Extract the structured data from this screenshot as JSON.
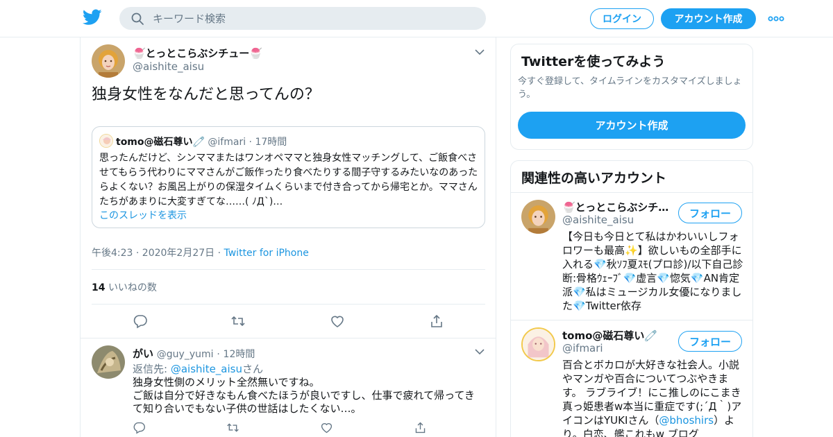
{
  "header": {
    "search_placeholder": "キーワード検索",
    "login_label": "ログイン",
    "signup_label": "アカウント作成"
  },
  "tweet": {
    "display_name": "🍧とっとこらぶシチュー🍧",
    "handle": "@aishite_aisu",
    "text": "独身女性をなんだと思ってんの？",
    "quote": {
      "name": "tomo@磁石尊い🧷",
      "handle": "@ifmari",
      "dot": "·",
      "time": "17時間",
      "text": "思ったんだけど、シンママまたはワンオペママと独身女性マッチングして、ご飯食べさせてもらう代わりにママさんがご飯作ったり食べたりする間子守するみたいなのあったらよくない？お風呂上がりの保湿タイムくらいまで付き合ってから帰宅とか。ママさんたちがあまりに大変すぎてな……( ﾉД`)…",
      "thread_link": "このスレッドを表示"
    },
    "timestamp": "午後4:23 · 2020年2月27日 ·",
    "source": "Twitter for iPhone",
    "likes_count": "14",
    "likes_label": "いいねの数"
  },
  "reply": {
    "name": "がい",
    "handle": "@guy_yumi",
    "dot": "·",
    "time": "12時間",
    "reply_prefix": "返信先:",
    "reply_handle": "@aishite_aisu",
    "reply_suffix": "さん",
    "text": "独身女性側のメリット全然無いですね。\nご飯は自分で好きなもん食べたほうが良いですし、仕事で疲れて帰ってきて知り合いでもない子供の世話はしたくない…。"
  },
  "sidebar": {
    "try_title": "Twitterを使ってみよう",
    "try_sub": "今すぐ登録して、タイムラインをカスタマイズしましょう。",
    "try_button": "アカウント作成",
    "related_title": "関連性の高いアカウント",
    "follow_label": "フォロー",
    "accounts": [
      {
        "name": "🍧とっとこらぶシチュー🍧",
        "handle": "@aishite_aisu",
        "bio": "【今日も今日とて私はかわいいしフォロワーも最高✨】欲しいもの全部手に入れる💎秋ｿﾌ夏ｽﾓ(プロ診)/以下自己診断:骨格ｳｪｰﾌﾞ💎虚言💎惚気💎AN肯定派💎私はミュージカル女優になりました💎Twitter依存"
      },
      {
        "name": "tomo@磁石尊い🧷",
        "handle": "@ifmari",
        "bio_pre": "百合とボカロが大好きな社会人。小説やマンガや百合についてつぶやきます。 ラブライブ！にこ推しのにこまき真っ姫患者w本当に重症です(;´Д｀)アイコンはYUKIさん（",
        "bio_link": "@bhoshirs",
        "bio_post": "）より。白恋、艦これもw ブログ"
      }
    ]
  },
  "colors": {
    "accent": "#1da1f2",
    "link": "#1b95e0",
    "muted": "#657786",
    "border": "#e6ecf0"
  },
  "icons": [
    "twitter-bird-icon",
    "search-icon",
    "more-icon",
    "chevron-down-icon",
    "reply-icon",
    "retweet-icon",
    "like-icon",
    "share-icon"
  ]
}
